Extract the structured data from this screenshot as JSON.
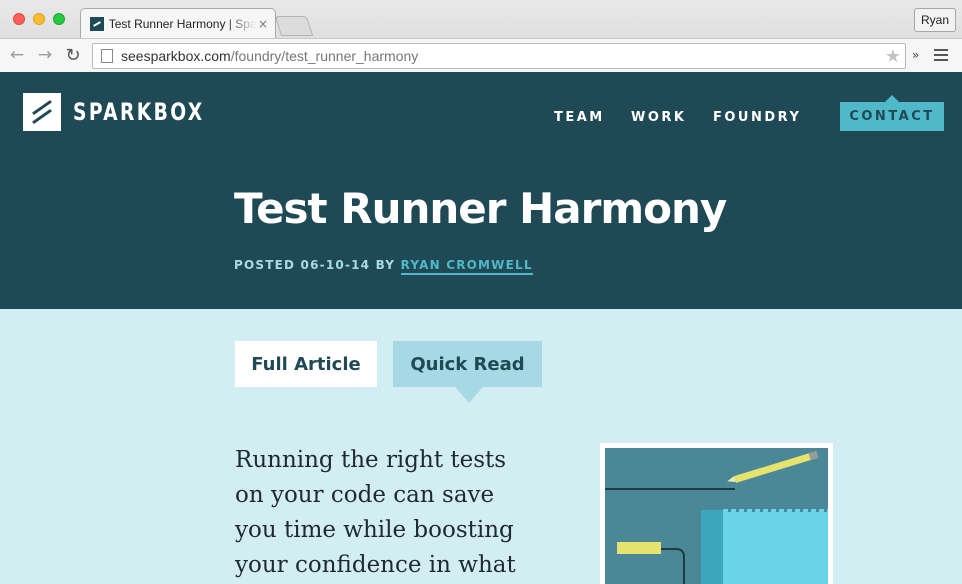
{
  "browser": {
    "tab_title": "Test Runner Harmony | Sparkbox",
    "tab_close": "×",
    "user_label": "Ryan",
    "url_host": "seesparkbox.com",
    "url_path": "/foundry/test_runner_harmony",
    "overflow": "»"
  },
  "site": {
    "logo_text": "SPARKBOX",
    "nav": {
      "team": "TEAM",
      "work": "WORK",
      "foundry": "FOUNDRY",
      "contact": "CONTACT"
    }
  },
  "article": {
    "title": "Test Runner Harmony",
    "byline_prefix": "POSTED 06-10-14 BY ",
    "author": "RYAN CROMWELL",
    "tabs": {
      "full": "Full Article",
      "quick": "Quick Read"
    },
    "intro": "Running the right tests on your code can save you time while boosting your confidence in what"
  },
  "colors": {
    "header_bg": "#1f4a55",
    "body_bg": "#d3eef3",
    "accent": "#4fb8c9",
    "tab_active": "#a6d9e3"
  }
}
